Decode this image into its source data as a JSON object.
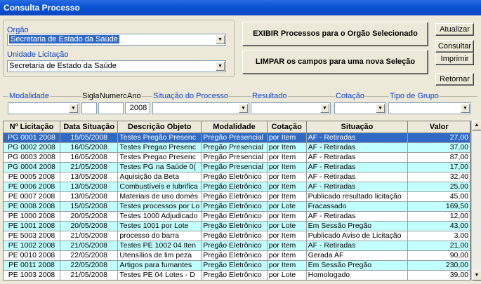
{
  "window": {
    "title": "Consulta Processo"
  },
  "orgao": {
    "label": "Orgão",
    "value": "Secretaria de Estado da Saúde"
  },
  "unidade": {
    "label": "Unidade Licitação",
    "value": "Secretaria de Estado da Saúde"
  },
  "buttons": {
    "exibir": "EXIBIR Processos para o Orgão Selecionado",
    "limpar": "LIMPAR os campos para uma nova Seleção",
    "atualizar": "Atualizar",
    "consultar": "Consultar",
    "imprimir": "Imprimir",
    "retornar": "Retornar"
  },
  "filters": {
    "modalidade": {
      "label": "Modalidade",
      "value": ""
    },
    "sigla": {
      "label": "Sigla",
      "value": ""
    },
    "numero": {
      "label": "Numero",
      "value": ""
    },
    "ano": {
      "label": "Ano",
      "value": "2008"
    },
    "situacao_processo": {
      "label": "Situação do Processo",
      "value": ""
    },
    "resultado": {
      "label": "Resultado",
      "value": ""
    },
    "cotacao": {
      "label": "Cotação",
      "value": ""
    },
    "tipo_grupo": {
      "label": "Tipo de Grupo",
      "value": ""
    }
  },
  "grid": {
    "columns": [
      "Nº Licitação",
      "Data Situação",
      "Descrição Objeto",
      "Modalidade",
      "Cotação",
      "Situação",
      "Valor"
    ],
    "rows": [
      [
        "PG 0001 2008",
        "15/05/2008",
        "Testes Pregão Presenc",
        "Pregão Presencial",
        "por Item",
        "AF - Retiradas",
        "27,00"
      ],
      [
        "PG 0002 2008",
        "16/05/2008",
        "Testes Pregao Presenc",
        "Pregão Presencial",
        "por Item",
        "AF - Retiradas",
        "37,00"
      ],
      [
        "PG 0003 2008",
        "16/05/2008",
        "Testes Pregao Presenc",
        "Pregão Presencial",
        "por Item",
        "AF - Retiradas",
        "87,00"
      ],
      [
        "PG 0004 2008",
        "21/05/2008",
        "Testes PG na Saúde 0(",
        "Pregão Presencial",
        "por Item",
        "AF - Retiradas",
        "17,00"
      ],
      [
        "PE 0005 2008",
        "13/05/2008",
        "Aquisição da Beta",
        "Pregão Eletrônico",
        "por Item",
        "AF - Retiradas",
        "32,40"
      ],
      [
        "PE 0006 2008",
        "13/05/2008",
        "Combustíveis e lubrifica",
        "Pregão Eletrônico",
        "por Item",
        "AF - Retiradas",
        "25,00"
      ],
      [
        "PE 0007 2008",
        "13/05/2008",
        "Materiais de uso domés",
        "Pregão Eletrônico",
        "por Item",
        "Publicado resultado licitação",
        "45,00"
      ],
      [
        "PE 0008 2008",
        "15/05/2008",
        "Testes processos por Lo",
        "Pregão Eletrônico",
        "por Lote",
        "Fracassado",
        "169,50"
      ],
      [
        "PE 1000 2008",
        "20/05/2008",
        "Testes 1000 Adjudicado",
        "Pregão Eletrônico",
        "por Item",
        "AF - Retiradas",
        "12,00"
      ],
      [
        "PE 1001 2008",
        "20/05/2008",
        "Testes 1001 por Lote",
        "Pregão Eletrônico",
        "por Lote",
        "Em Sessão Pregão",
        "43,00"
      ],
      [
        "PE 5003 2008",
        "21/05/2008",
        "processo do barra",
        "Pregão Eletrônico",
        "por Item",
        "Publicado Aviso de Licitação",
        "3,00"
      ],
      [
        "PE 1002 2008",
        "21/05/2008",
        "Testes PE 1002 04 Iten",
        "Pregão Eletrônico",
        "por Item",
        "AF - Retiradas",
        "21,00"
      ],
      [
        "PE 0010 2008",
        "22/05/2008",
        "Utensílios de lim peza",
        "Pregão Eletrônico",
        "por Item",
        "Gerada AF",
        "90,00"
      ],
      [
        "PE 0011 2008",
        "22/05/2008",
        "Artigos para fumantes",
        "Pregão Eletrônico",
        "por Item",
        "Em Sessão Pregão",
        "230,00"
      ],
      [
        "PE 1003 2008",
        "21/05/2008",
        "Testes PE 04 Lotes - D",
        "Pregão Eletrônico",
        "por Lote",
        "Homologado",
        "39,00"
      ]
    ]
  }
}
